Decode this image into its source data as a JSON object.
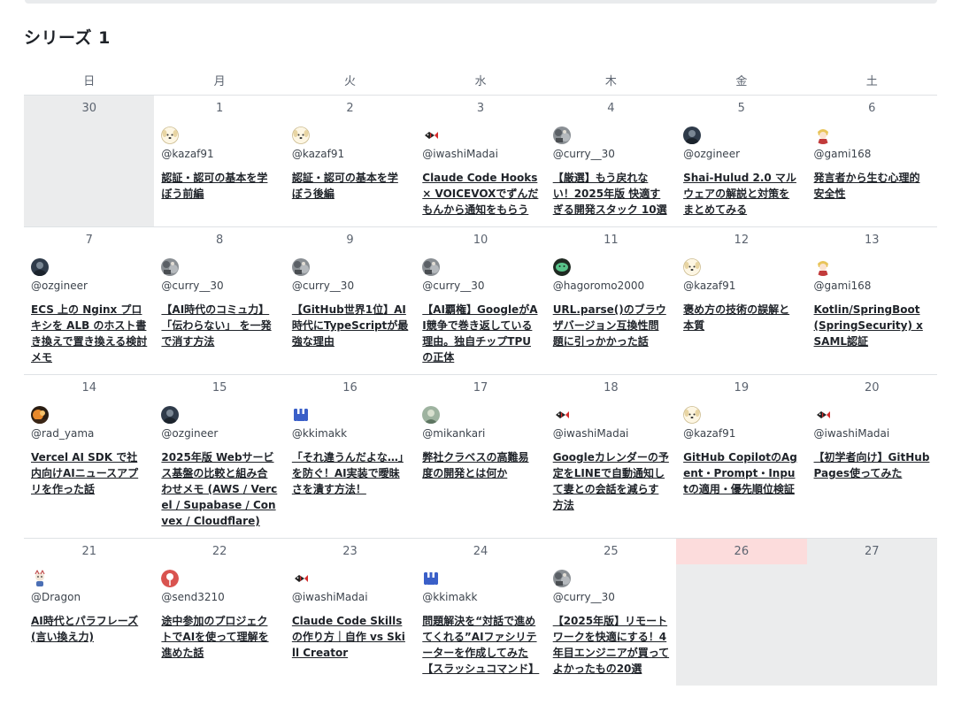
{
  "title": "シリーズ 1",
  "weekdays": [
    "日",
    "月",
    "火",
    "水",
    "木",
    "金",
    "土"
  ],
  "weeks": [
    [
      {
        "day": "30",
        "gray": true
      },
      {
        "day": "1",
        "user": "@kazaf91",
        "avatar": "dog",
        "article": "認証・認可の基本を学ぼう前編"
      },
      {
        "day": "2",
        "user": "@kazaf91",
        "avatar": "dog",
        "article": "認証・認可の基本を学ぼう後編"
      },
      {
        "day": "3",
        "user": "@iwashiMadai",
        "avatar": "fish",
        "article": "Claude Code Hooks × VOICEVOXでずんだもんから通知をもらう"
      },
      {
        "day": "4",
        "user": "@curry__30",
        "avatar": "photo-gray",
        "article": "【厳選】もう戻れない！2025年版 快適すぎる開発スタック 10選"
      },
      {
        "day": "5",
        "user": "@ozgineer",
        "avatar": "photo-dark",
        "article": "Shai-Hulud 2.0 マルウェアの解説と対策をまとめてみる"
      },
      {
        "day": "6",
        "user": "@gami168",
        "avatar": "character",
        "article": "発言者から生む心理的安全性"
      }
    ],
    [
      {
        "day": "7",
        "user": "@ozgineer",
        "avatar": "photo-dark",
        "article": "ECS 上の Nginx プロキシを ALB のホスト書き換えで置き換える検討メモ"
      },
      {
        "day": "8",
        "user": "@curry__30",
        "avatar": "photo-gray",
        "article": "【AI時代のコミュ力】「伝わらない」 を一発で消す方法"
      },
      {
        "day": "9",
        "user": "@curry__30",
        "avatar": "photo-gray",
        "article": "【GitHub世界1位】AI時代にTypeScriptが最強な理由"
      },
      {
        "day": "10",
        "user": "@curry__30",
        "avatar": "photo-gray",
        "article": "【AI覇権】GoogleがAI競争で巻き返している理由。独自チップTPUの正体"
      },
      {
        "day": "11",
        "user": "@hagoromo2000",
        "avatar": "green",
        "article": "URL.parse()のブラウザバージョン互換性問題に引っかかった話"
      },
      {
        "day": "12",
        "user": "@kazaf91",
        "avatar": "dog",
        "article": "褒め方の技術の誤解と本質"
      },
      {
        "day": "13",
        "user": "@gami168",
        "avatar": "character",
        "article": "Kotlin/SpringBoot(SpringSecurity) x SAML認証"
      }
    ],
    [
      {
        "day": "14",
        "user": "@rad_yama",
        "avatar": "photo-orange",
        "article": "Vercel AI SDK で社内向けAIニュースアプリを作った話"
      },
      {
        "day": "15",
        "user": "@ozgineer",
        "avatar": "photo-dark",
        "article": "2025年版 Webサービス基盤の比較と組み合わせメモ (AWS / Vercel / Supabase / Convex / Cloudflare)"
      },
      {
        "day": "16",
        "user": "@kkimakk",
        "avatar": "robot",
        "article": "「それ違うんだよな…」を防ぐ！AI実装で曖昧さを潰す方法！"
      },
      {
        "day": "17",
        "user": "@mikankari",
        "avatar": "photo-green",
        "article": "弊社クラベスの高難易度の開発とは何か"
      },
      {
        "day": "18",
        "user": "@iwashiMadai",
        "avatar": "fish",
        "article": "Googleカレンダーの予定をLINEで自動通知して妻との会話を減らす方法"
      },
      {
        "day": "19",
        "user": "@kazaf91",
        "avatar": "dog",
        "article": "GitHub CopilotのAgent・Prompt・Inputの適用・優先順位検証"
      },
      {
        "day": "20",
        "user": "@iwashiMadai",
        "avatar": "fish",
        "article": "【初学者向け】GitHub Pages使ってみた"
      }
    ],
    [
      {
        "day": "21",
        "user": "@Dragon",
        "avatar": "dragon",
        "article": "AI時代とパラフレーズ(言い換え力)"
      },
      {
        "day": "22",
        "user": "@send3210",
        "avatar": "pin",
        "article": "途中参加のプロジェクトでAIを使って理解を進めた話"
      },
      {
        "day": "23",
        "user": "@iwashiMadai",
        "avatar": "fish",
        "article": "Claude Code Skillsの作り方｜自作 vs Skill Creator"
      },
      {
        "day": "24",
        "user": "@kkimakk",
        "avatar": "robot",
        "article": "問題解決を“対話で進めてくれる”AIファシリテーターを作成してみた【スラッシュコマンド】"
      },
      {
        "day": "25",
        "user": "@curry__30",
        "avatar": "photo-gray",
        "article": "【2025年版】リモートワークを快適にする！4年目エンジニアが買ってよかったもの20選"
      },
      {
        "day": "26",
        "today": true,
        "gray": true
      },
      {
        "day": "27",
        "gray": true
      }
    ]
  ]
}
